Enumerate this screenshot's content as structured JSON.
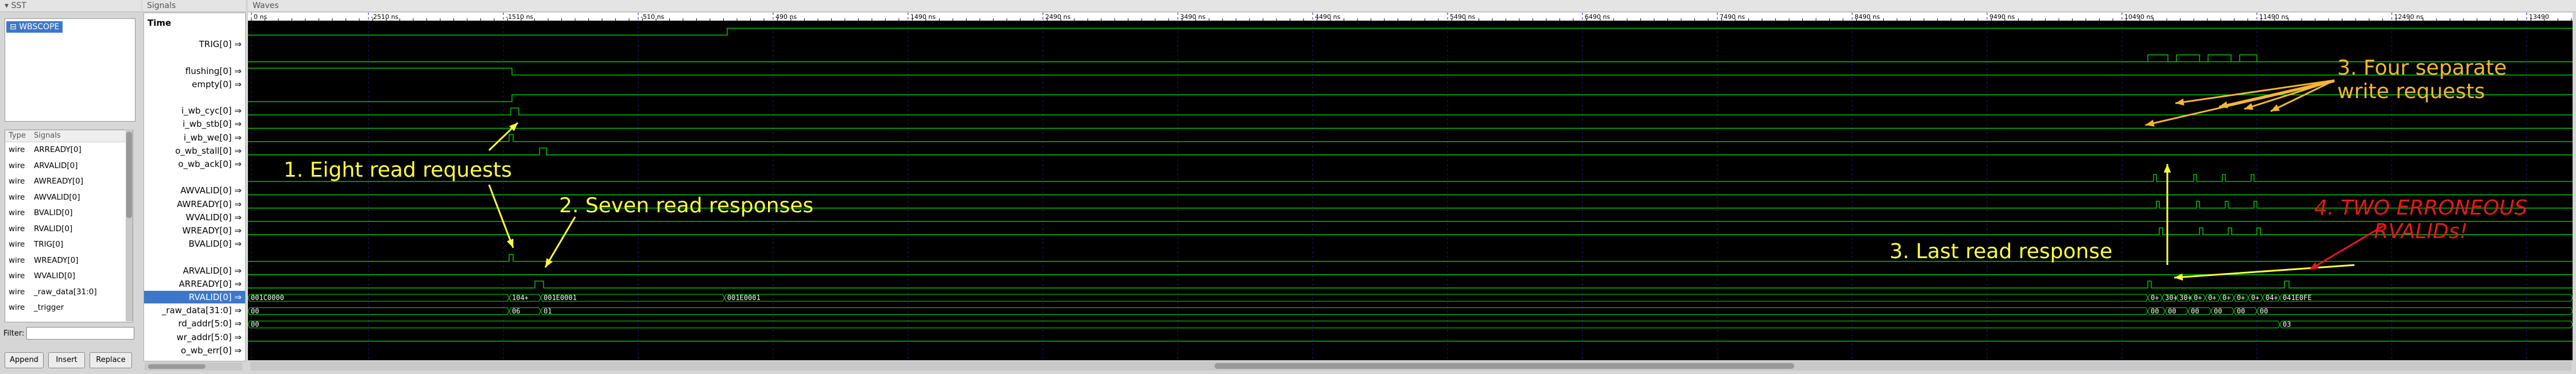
{
  "sst": {
    "title": "SST",
    "scope": "WBSCOPE",
    "type_header": "Type",
    "signals_header": "Signals",
    "rows": [
      {
        "type": "wire",
        "name": "ARREADY[0]"
      },
      {
        "type": "wire",
        "name": "ARVALID[0]"
      },
      {
        "type": "wire",
        "name": "AWREADY[0]"
      },
      {
        "type": "wire",
        "name": "AWVALID[0]"
      },
      {
        "type": "wire",
        "name": "BVALID[0]"
      },
      {
        "type": "wire",
        "name": "RVALID[0]"
      },
      {
        "type": "wire",
        "name": "TRIG[0]"
      },
      {
        "type": "wire",
        "name": "WREADY[0]"
      },
      {
        "type": "wire",
        "name": "WVALID[0]"
      },
      {
        "type": "wire",
        "name": "_raw_data[31:0]"
      },
      {
        "type": "wire",
        "name": "_trigger"
      }
    ],
    "filter_label": "Filter:",
    "filter_value": "",
    "buttons": {
      "append": "Append",
      "insert": "Insert",
      "replace": "Replace"
    }
  },
  "signals": {
    "title": "Signals",
    "time_label": "Time",
    "list": [
      {
        "name": "TRIG[0]",
        "row": 1
      },
      {
        "name": "flushing[0]",
        "row": 3
      },
      {
        "name": "empty[0]",
        "row": 4
      },
      {
        "name": "i_wb_cyc[0]",
        "row": 6
      },
      {
        "name": "i_wb_stb[0]",
        "row": 7
      },
      {
        "name": "i_wb_we[0]",
        "row": 8
      },
      {
        "name": "o_wb_stall[0]",
        "row": 9
      },
      {
        "name": "o_wb_ack[0]",
        "row": 10
      },
      {
        "name": "AWVALID[0]",
        "row": 12
      },
      {
        "name": "AWREADY[0]",
        "row": 13
      },
      {
        "name": "WVALID[0]",
        "row": 14
      },
      {
        "name": "WREADY[0]",
        "row": 15
      },
      {
        "name": "BVALID[0]",
        "row": 16
      },
      {
        "name": "ARVALID[0]",
        "row": 18
      },
      {
        "name": "ARREADY[0]",
        "row": 19
      },
      {
        "name": "RVALID[0]",
        "row": 20,
        "selected": true
      },
      {
        "name": "_raw_data[31:0]",
        "row": 21
      },
      {
        "name": "rd_addr[5:0]",
        "row": 22
      },
      {
        "name": "wr_addr[5:0]",
        "row": 23
      },
      {
        "name": "o_wb_err[0]",
        "row": 24
      }
    ]
  },
  "waves": {
    "title": "Waves",
    "time_ticks": [
      "0 ns",
      "-2510 ns",
      "-1510 ns",
      "-510 ns",
      "490 ns",
      "1490 ns",
      "2490 ns",
      "3490 ns",
      "4490 ns",
      "5490 ns",
      "6490 ns",
      "7490 ns",
      "8490 ns",
      "9490 ns",
      "10490 ns",
      "11490 ns",
      "12490 ns",
      "13490"
    ],
    "bus_labels": {
      "raw_data": [
        "001C0000",
        "104+",
        "001E0001",
        "001E0001",
        "0+",
        "30+",
        "30+",
        "0+",
        "0+",
        "0+",
        "0+",
        "0+",
        "04+",
        "041E0FE"
      ],
      "rd_addr": [
        "00",
        "06",
        "01",
        "00",
        "00",
        "00",
        "00",
        "00",
        "00"
      ],
      "wr_addr": [
        "00",
        "03"
      ]
    },
    "colors": {
      "wave": "#00c400",
      "grid": "#1a1a7a",
      "annotation_yellow": "#ffff3a",
      "annotation_orange": "#f5b732",
      "annotation_red": "#e81818",
      "selected": "#3d77c9"
    }
  },
  "annotations": {
    "a1": "1. Eight read requests",
    "a2": "2. Seven read responses",
    "a3_line1": "3. Four separate",
    "a3_line2": "write requests",
    "a4": "3. Last read response",
    "a5_line1": "4. TWO ERRONEOUS",
    "a5_line2": "RVALIDs!"
  }
}
